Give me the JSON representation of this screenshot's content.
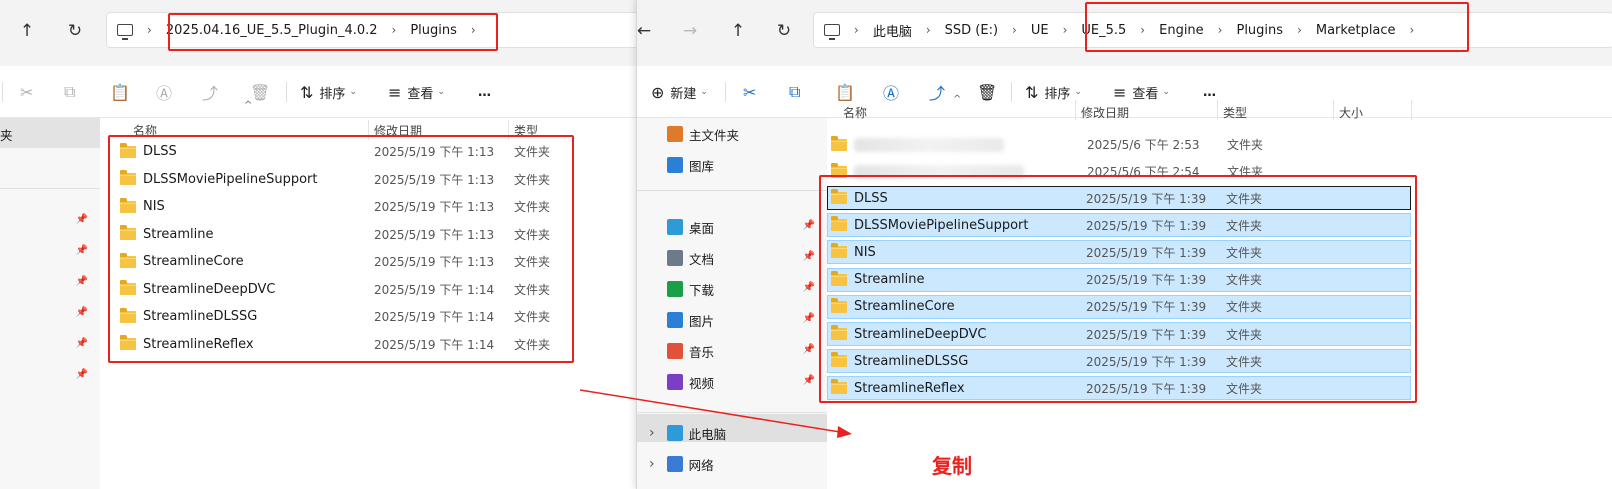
{
  "left": {
    "breadcrumbs": [
      "2025.04.16_UE_5.5_Plugin_4.0.2",
      "Plugins"
    ],
    "toolbar": {
      "sort": "排序",
      "view": "查看",
      "more": "…"
    },
    "columns": {
      "name": "名称",
      "date": "修改日期",
      "type": "类型"
    },
    "nav_partial_label": "夹",
    "files": [
      {
        "name": "DLSS",
        "date": "2025/5/19 下午 1:13",
        "type": "文件夹"
      },
      {
        "name": "DLSSMoviePipelineSupport",
        "date": "2025/5/19 下午 1:13",
        "type": "文件夹"
      },
      {
        "name": "NIS",
        "date": "2025/5/19 下午 1:13",
        "type": "文件夹"
      },
      {
        "name": "Streamline",
        "date": "2025/5/19 下午 1:13",
        "type": "文件夹"
      },
      {
        "name": "StreamlineCore",
        "date": "2025/5/19 下午 1:13",
        "type": "文件夹"
      },
      {
        "name": "StreamlineDeepDVC",
        "date": "2025/5/19 下午 1:14",
        "type": "文件夹"
      },
      {
        "name": "StreamlineDLSSG",
        "date": "2025/5/19 下午 1:14",
        "type": "文件夹"
      },
      {
        "name": "StreamlineReflex",
        "date": "2025/5/19 下午 1:14",
        "type": "文件夹"
      }
    ]
  },
  "right": {
    "breadcrumbs": [
      "此电脑",
      "SSD (E:)",
      "UE",
      "UE_5.5",
      "Engine",
      "Plugins",
      "Marketplace"
    ],
    "toolbar": {
      "new": "新建",
      "sort": "排序",
      "view": "查看",
      "more": "…"
    },
    "columns": {
      "name": "名称",
      "date": "修改日期",
      "type": "类型",
      "size": "大小"
    },
    "nav": [
      {
        "label": "主文件夹",
        "icon": "home-icon",
        "color": "#e07a2b"
      },
      {
        "label": "图库",
        "icon": "gallery-icon",
        "color": "#2b7fd6"
      },
      {
        "label": "桌面",
        "icon": "desktop-icon",
        "color": "#2e9ad8"
      },
      {
        "label": "文档",
        "icon": "documents-icon",
        "color": "#6c7a8a"
      },
      {
        "label": "下载",
        "icon": "download-icon",
        "color": "#1a9e4a"
      },
      {
        "label": "图片",
        "icon": "pictures-icon",
        "color": "#2b7fd6"
      },
      {
        "label": "音乐",
        "icon": "music-icon",
        "color": "#e0533a"
      },
      {
        "label": "视频",
        "icon": "videos-icon",
        "color": "#7a3fc4"
      },
      {
        "label": "此电脑",
        "icon": "this-pc-icon",
        "color": "#2e9ad8"
      },
      {
        "label": "网络",
        "icon": "network-icon",
        "color": "#3a7bd5"
      }
    ],
    "blurred_files": [
      {
        "date": "2025/5/6 下午 2:53",
        "type": "文件夹"
      },
      {
        "date": "2025/5/6 下午 2:54",
        "type": "文件夹"
      }
    ],
    "files": [
      {
        "name": "DLSS",
        "date": "2025/5/19 下午 1:39",
        "type": "文件夹"
      },
      {
        "name": "DLSSMoviePipelineSupport",
        "date": "2025/5/19 下午 1:39",
        "type": "文件夹"
      },
      {
        "name": "NIS",
        "date": "2025/5/19 下午 1:39",
        "type": "文件夹"
      },
      {
        "name": "Streamline",
        "date": "2025/5/19 下午 1:39",
        "type": "文件夹"
      },
      {
        "name": "StreamlineCore",
        "date": "2025/5/19 下午 1:39",
        "type": "文件夹"
      },
      {
        "name": "StreamlineDeepDVC",
        "date": "2025/5/19 下午 1:39",
        "type": "文件夹"
      },
      {
        "name": "StreamlineDLSSG",
        "date": "2025/5/19 下午 1:39",
        "type": "文件夹"
      },
      {
        "name": "StreamlineReflex",
        "date": "2025/5/19 下午 1:39",
        "type": "文件夹"
      }
    ]
  },
  "annotation": {
    "label": "复制",
    "color": "#e8231f"
  }
}
